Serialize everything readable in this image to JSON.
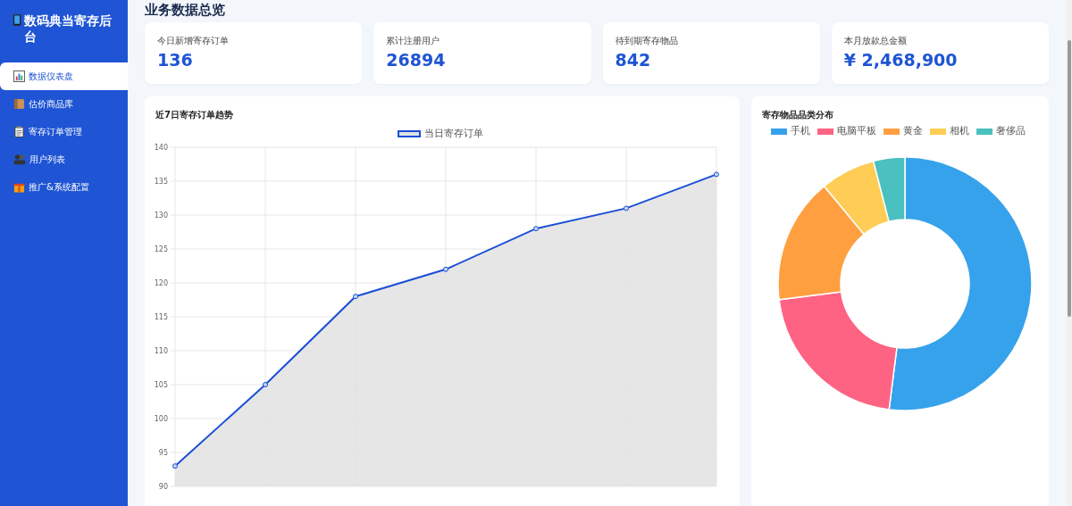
{
  "sidebar": {
    "logo": "数码典当寄存后台",
    "items": [
      {
        "label": "数据仪表盘",
        "selected": true
      },
      {
        "label": "估价商品库",
        "selected": false
      },
      {
        "label": "寄存订单管理",
        "selected": false
      },
      {
        "label": "用户列表",
        "selected": false
      },
      {
        "label": "推广&系统配置",
        "selected": false
      }
    ]
  },
  "page_title": "业务数据总览",
  "stats": [
    {
      "label": "今日新增寄存订单",
      "value": "136"
    },
    {
      "label": "累计注册用户",
      "value": "26894"
    },
    {
      "label": "待到期寄存物品",
      "value": "842"
    },
    {
      "label": "本月放款总金额",
      "value": "¥ 2,468,900"
    }
  ],
  "trend_card": {
    "title": "近7日寄存订单趋势",
    "chart_data": {
      "type": "area",
      "ylim": [
        90,
        140
      ],
      "yticks": [
        90,
        95,
        100,
        105,
        110,
        115,
        120,
        125,
        130,
        135,
        140
      ],
      "grid": true,
      "series": [
        {
          "name": "当日寄存订单",
          "color": "#1a4fd6",
          "values": [
            93,
            105,
            118,
            122,
            128,
            131,
            136
          ]
        }
      ]
    }
  },
  "category_card": {
    "title": "寄存物品品类分布",
    "chart_data": {
      "type": "donut",
      "categories": [
        "手机",
        "电脑平板",
        "黄金",
        "相机",
        "奢侈品"
      ],
      "series": [
        {
          "colors": [
            "#36a2eb",
            "#ff6384",
            "#ff9f40",
            "#ffcd56",
            "#4bc0c0"
          ],
          "values": [
            52,
            21,
            16,
            7,
            4
          ]
        }
      ]
    }
  }
}
